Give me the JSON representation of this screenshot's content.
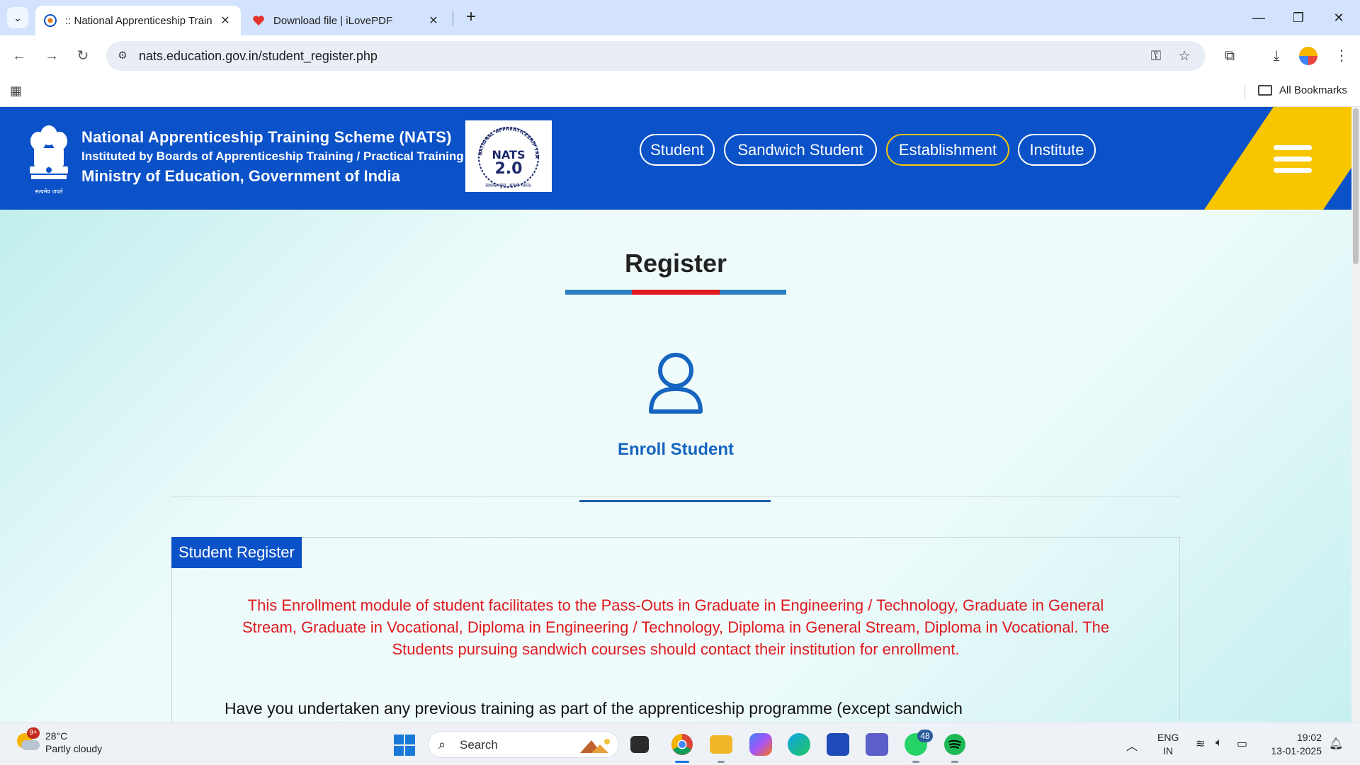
{
  "browser": {
    "tabs": [
      {
        "title": ":: National Apprenticeship Train",
        "active": true
      },
      {
        "title": "Download file | iLovePDF",
        "active": false
      }
    ],
    "url": "nats.education.gov.in/student_register.php",
    "all_bookmarks": "All Bookmarks"
  },
  "header": {
    "org_line1": "National Apprenticeship Training Scheme (NATS)",
    "org_line2": "Instituted by Boards of Apprenticeship Training / Practical Training",
    "org_line3": "Ministry of Education, Government of India",
    "emblem_caption": "सत्यमेव जयते",
    "logo_ring_text": "NATIONAL APPRENTICESHIP TRAINING SCHEME",
    "logo_main": "NATS",
    "logo_version": "2.0",
    "logo_tagline": "सशक्त युवा, समर्थ भारत।",
    "nav": [
      "Student",
      "Sandwich Student",
      "Establishment",
      "Institute"
    ]
  },
  "main": {
    "title": "Register",
    "enroll_label": "Enroll Student",
    "panel_tab": "Student Register",
    "notice": "This Enrollment module of student facilitates to the Pass-Outs in Graduate in Engineering / Technology, Graduate in General Stream, Graduate in Vocational, Diploma in Engineering / Technology, Diploma in General Stream, Diploma in Vocational. The Students pursuing sandwich courses should contact their institution for enrollment.",
    "question": "Have you undertaken any previous training as part of the apprenticeship programme (except sandwich"
  },
  "taskbar": {
    "weather_badge": "9+",
    "temperature": "28°C",
    "weather_desc": "Partly cloudy",
    "search_label": "Search",
    "whatsapp_badge": "48",
    "lang_line1": "ENG",
    "lang_line2": "IN",
    "time": "19:02",
    "date": "13-01-2025"
  },
  "colors": {
    "header_blue": "#0b52c9",
    "accent_yellow": "#f7c600",
    "notice_red": "#e0191e",
    "enroll_blue": "#1565c0"
  }
}
